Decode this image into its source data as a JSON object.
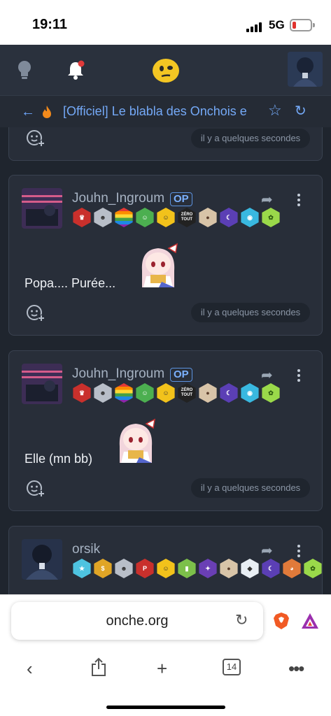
{
  "status_bar": {
    "time": "19:11",
    "network": "5G"
  },
  "topic": {
    "title": "[Officiel] Le blabla des Onchois e"
  },
  "posts": [
    {
      "timestamp": "il y a quelques secondes"
    },
    {
      "username": "Jouhn_Ingroum",
      "op_label": "OP",
      "text": "Popa.... Purée...",
      "timestamp": "il y a quelques secondes",
      "badges": [
        "crown-badge",
        "mask-badge",
        "rainbow-badge",
        "santa-badge",
        "smiley-badge",
        "zero-tout-badge",
        "dog-badge",
        "moon-badge",
        "gamepad-badge",
        "cat-badge"
      ],
      "zero_tout_label": "ZÉRO TOUT"
    },
    {
      "username": "Jouhn_Ingroum",
      "op_label": "OP",
      "text": "Elle (mn bb)",
      "timestamp": "il y a quelques secondes",
      "badges": [
        "crown-badge",
        "mask-badge",
        "rainbow-badge",
        "santa-badge",
        "smiley-badge",
        "zero-tout-badge",
        "dog-badge",
        "moon-badge",
        "gamepad-badge",
        "cat-badge"
      ],
      "zero_tout_label": "ZÉRO TOUT"
    },
    {
      "username": "orsik",
      "badges": [
        "star-badge",
        "dollar-badge",
        "mask-badge",
        "p-badge",
        "smiley-badge",
        "beer-badge",
        "wizard-badge",
        "dog-badge",
        "husky-badge",
        "moon-badge",
        "palette-badge",
        "cat-badge"
      ],
      "p_label": "P"
    }
  ],
  "browser": {
    "url": "onche.org",
    "tabs_count": "14"
  },
  "colors": {
    "accent": "#74a9f7",
    "background": "#1f252e",
    "card": "#282e39"
  }
}
